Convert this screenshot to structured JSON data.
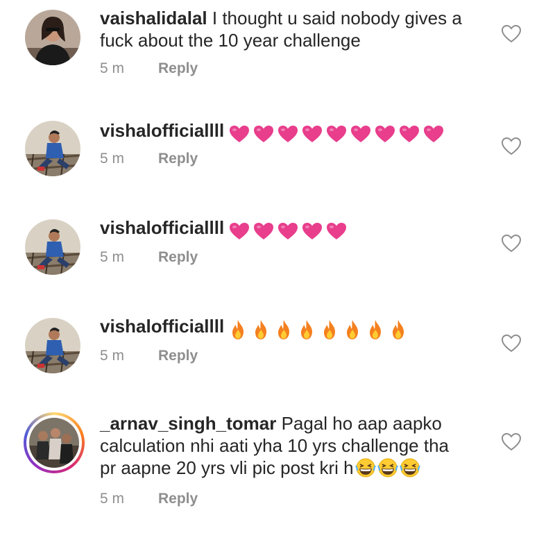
{
  "colors": {
    "text": "#262626",
    "muted": "#8e8e8e",
    "heart_emoji": "#e83e8c",
    "fire_outer": "#f4801f",
    "fire_inner": "#ffcc33",
    "grin_face": "#ffcc33"
  },
  "comments": [
    {
      "username": "vaishalidalal",
      "text": "I thought u said nobody gives a fuck about the 10 year challenge",
      "time": "5 m",
      "reply_label": "Reply",
      "avatar": "woman-portrait",
      "emoji": "none"
    },
    {
      "username": "vishalofficiallll",
      "text": "",
      "time": "5 m",
      "reply_label": "Reply",
      "avatar": "man-sitting-on-tracks",
      "emoji": "heart-emoji",
      "emoji_count": 9
    },
    {
      "username": "vishalofficiallll",
      "text": "",
      "time": "5 m",
      "reply_label": "Reply",
      "avatar": "man-sitting-on-tracks",
      "emoji": "heart-emoji",
      "emoji_count": 5
    },
    {
      "username": "vishalofficiallll",
      "text": "",
      "time": "5 m",
      "reply_label": "Reply",
      "avatar": "man-sitting-on-tracks",
      "emoji": "fire-emoji",
      "emoji_count": 8
    },
    {
      "username": "_arnav_singh_tomar",
      "text_line1": "Pagal ho aap aapko",
      "text_line2": "calculation nhi aati yha 10 yrs challenge tha",
      "text_line3": "pr aapne 20 yrs vli pic post kri h",
      "time": "5 m",
      "reply_label": "Reply",
      "avatar": "group-photo-story-ring",
      "emoji": "grinning-squinting-emoji",
      "emoji_count": 3
    }
  ]
}
